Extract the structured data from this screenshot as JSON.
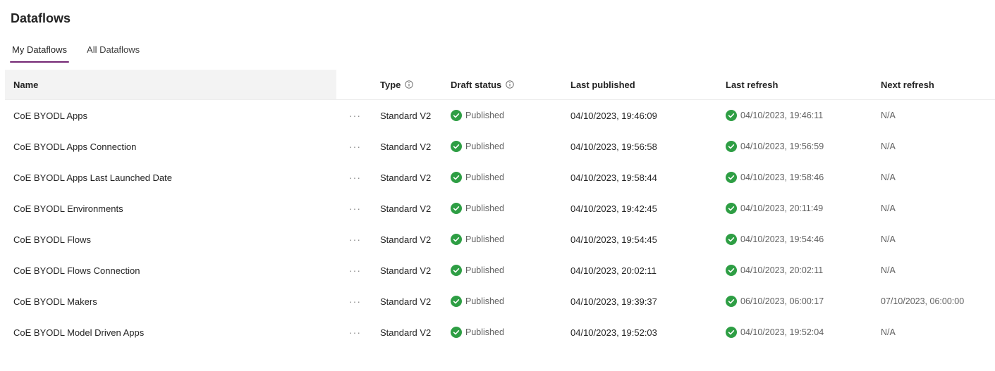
{
  "page": {
    "title": "Dataflows"
  },
  "tabs": [
    {
      "label": "My Dataflows",
      "active": true
    },
    {
      "label": "All Dataflows",
      "active": false
    }
  ],
  "columns": {
    "name": "Name",
    "type": "Type",
    "draft_status": "Draft status",
    "last_published": "Last published",
    "last_refresh": "Last refresh",
    "next_refresh": "Next refresh"
  },
  "more_label": "···",
  "rows": [
    {
      "name": "CoE BYODL Apps",
      "type": "Standard V2",
      "draft_status": "Published",
      "last_published": "04/10/2023, 19:46:09",
      "last_refresh": "04/10/2023, 19:46:11",
      "next_refresh": "N/A"
    },
    {
      "name": "CoE BYODL Apps Connection",
      "type": "Standard V2",
      "draft_status": "Published",
      "last_published": "04/10/2023, 19:56:58",
      "last_refresh": "04/10/2023, 19:56:59",
      "next_refresh": "N/A"
    },
    {
      "name": "CoE BYODL Apps Last Launched Date",
      "type": "Standard V2",
      "draft_status": "Published",
      "last_published": "04/10/2023, 19:58:44",
      "last_refresh": "04/10/2023, 19:58:46",
      "next_refresh": "N/A"
    },
    {
      "name": "CoE BYODL Environments",
      "type": "Standard V2",
      "draft_status": "Published",
      "last_published": "04/10/2023, 19:42:45",
      "last_refresh": "04/10/2023, 20:11:49",
      "next_refresh": "N/A"
    },
    {
      "name": "CoE BYODL Flows",
      "type": "Standard V2",
      "draft_status": "Published",
      "last_published": "04/10/2023, 19:54:45",
      "last_refresh": "04/10/2023, 19:54:46",
      "next_refresh": "N/A"
    },
    {
      "name": "CoE BYODL Flows Connection",
      "type": "Standard V2",
      "draft_status": "Published",
      "last_published": "04/10/2023, 20:02:11",
      "last_refresh": "04/10/2023, 20:02:11",
      "next_refresh": "N/A"
    },
    {
      "name": "CoE BYODL Makers",
      "type": "Standard V2",
      "draft_status": "Published",
      "last_published": "04/10/2023, 19:39:37",
      "last_refresh": "06/10/2023, 06:00:17",
      "next_refresh": "07/10/2023, 06:00:00"
    },
    {
      "name": "CoE BYODL Model Driven Apps",
      "type": "Standard V2",
      "draft_status": "Published",
      "last_published": "04/10/2023, 19:52:03",
      "last_refresh": "04/10/2023, 19:52:04",
      "next_refresh": "N/A"
    }
  ],
  "icons": {
    "info": "info-circle-icon",
    "status": "checkmark-circle-icon"
  },
  "colors": {
    "accent": "#742774",
    "success": "#2e9e44",
    "header_bg": "#f3f3f3"
  }
}
